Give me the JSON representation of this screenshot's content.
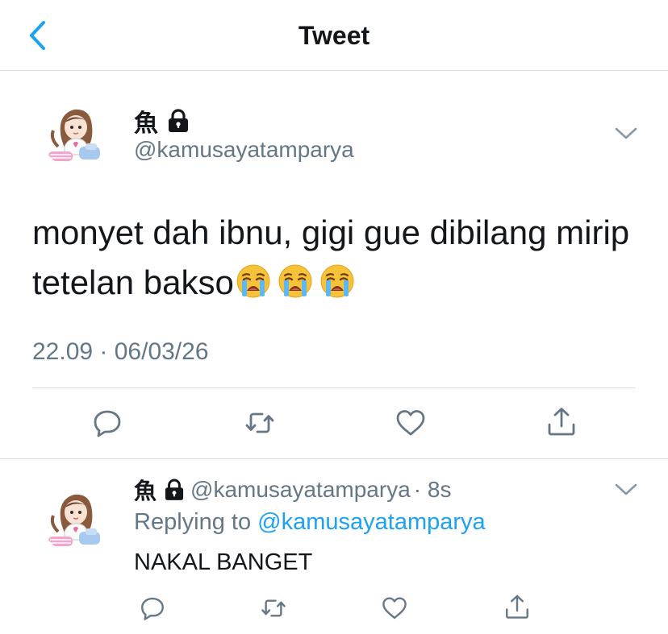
{
  "header": {
    "title": "Tweet",
    "back_icon": "chevron-left-icon",
    "accent": "#1da1f2"
  },
  "tweet": {
    "author_name": "魚",
    "handle": "@kamusayatamparya",
    "text": "monyet dah ibnu, gigi gue dibilang mirip tetelan bakso",
    "emojis": [
      "loudly-crying-face",
      "loudly-crying-face",
      "loudly-crying-face"
    ],
    "timestamp": "22.09 · 06/03/26",
    "actions": [
      "reply-icon",
      "retweet-icon",
      "like-icon",
      "share-icon"
    ]
  },
  "reply": {
    "author_name": "魚",
    "handle": "@kamusayatamparya",
    "time": "· 8s",
    "replying_prefix": "Replying to",
    "replying_to": "@kamusayatamparya",
    "text": "NAKAL BANGET",
    "actions": [
      "reply-icon",
      "retweet-icon",
      "like-icon",
      "share-icon"
    ]
  },
  "colors": {
    "text": "#14171a",
    "secondary": "#657786",
    "link": "#1da1f2",
    "divider": "#d9dde1"
  }
}
